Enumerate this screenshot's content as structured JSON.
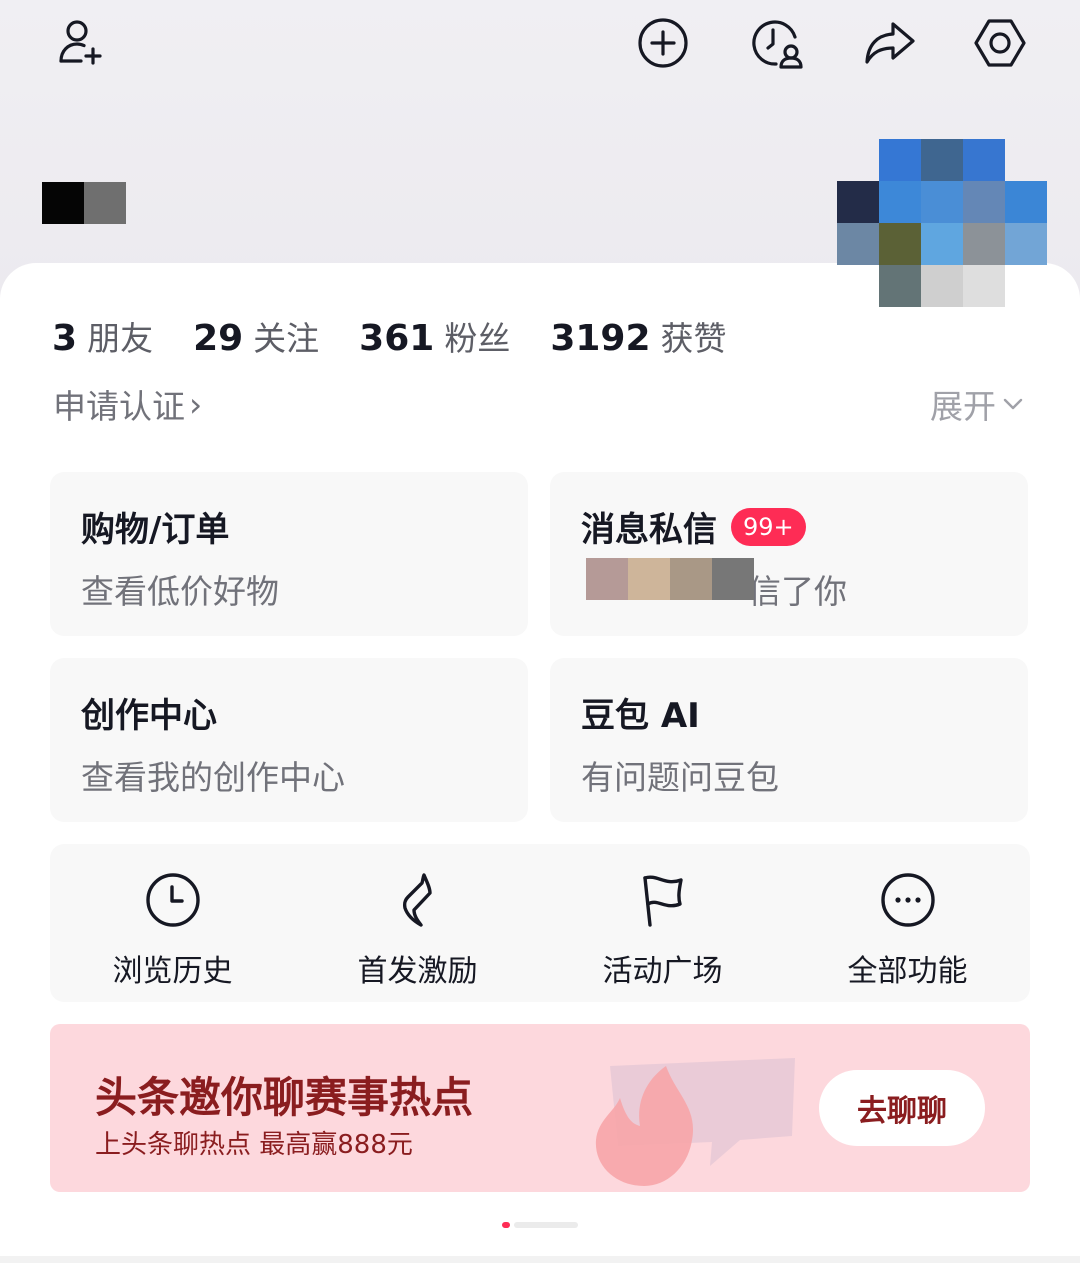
{
  "topbar": {
    "icons": [
      "add-friend-icon",
      "add-circle-icon",
      "visitor-history-icon",
      "share-icon",
      "settings-icon"
    ]
  },
  "profile": {
    "stats": [
      {
        "num": "3",
        "label": "朋友"
      },
      {
        "num": "29",
        "label": "关注"
      },
      {
        "num": "361",
        "label": "粉丝"
      },
      {
        "num": "3192",
        "label": "获赞"
      }
    ],
    "verify_label": "申请认证",
    "verify_chevron": "›",
    "expand_label": "展开"
  },
  "tiles": [
    {
      "title": "购物/订单",
      "subtitle": "查看低价好物"
    },
    {
      "title": "消息私信",
      "badge": "99+",
      "subtitle": "信了你"
    },
    {
      "title": "创作中心",
      "subtitle": "查看我的创作中心"
    },
    {
      "title": "豆包 AI",
      "subtitle": "有问题问豆包"
    }
  ],
  "shortcuts": [
    {
      "label": "浏览历史",
      "icon": "clock-icon"
    },
    {
      "label": "首发激励",
      "icon": "lightning-icon"
    },
    {
      "label": "活动广场",
      "icon": "flag-icon"
    },
    {
      "label": "全部功能",
      "icon": "more-icon"
    }
  ],
  "banner": {
    "title": "头条邀你聊赛事热点",
    "subtitle": "上头条聊热点 最高赢888元",
    "button": "去聊聊"
  },
  "colors": {
    "accent": "#fe2c55",
    "banner_bg": "#fdd8dd",
    "banner_text": "#8a1d1f",
    "tile_bg": "#f8f8f8"
  }
}
